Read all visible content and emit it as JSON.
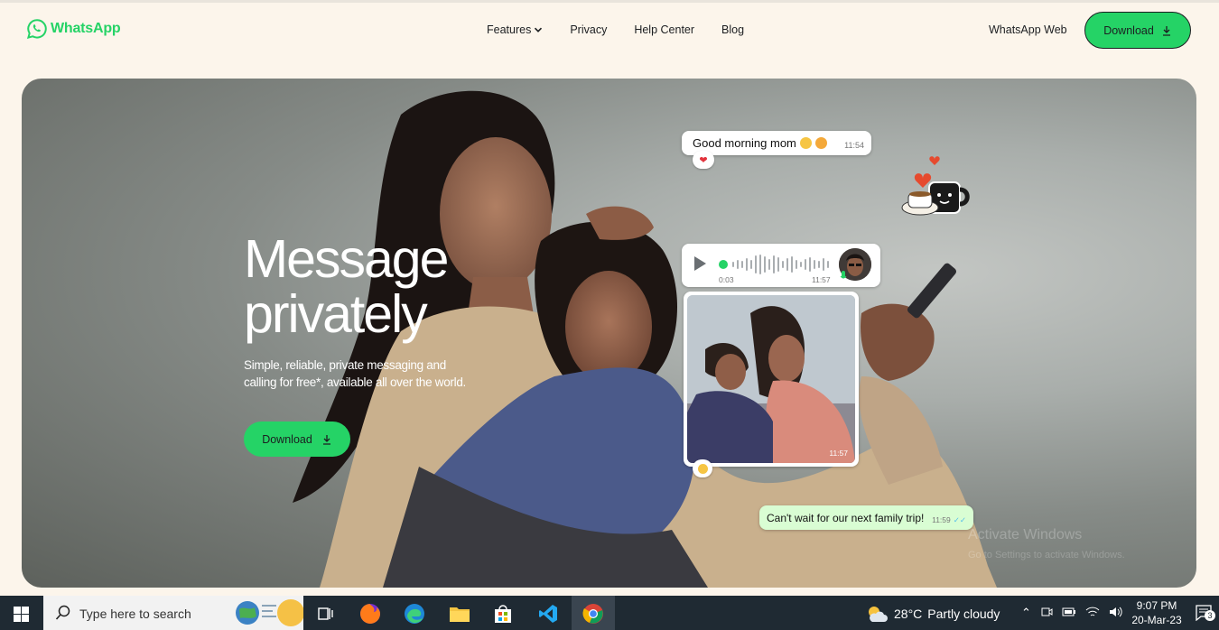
{
  "header": {
    "logo_text": "WhatsApp",
    "nav": [
      {
        "label": "Features",
        "has_dropdown": true
      },
      {
        "label": "Privacy"
      },
      {
        "label": "Help Center"
      },
      {
        "label": "Blog"
      }
    ],
    "whatsapp_web_label": "WhatsApp Web",
    "download_label": "Download"
  },
  "hero": {
    "title_line1": "Message",
    "title_line2": "privately",
    "subtitle": "Simple, reliable, private messaging and calling for free*, available all over the world.",
    "download_label": "Download",
    "chat": {
      "msg1_text": "Good morning mom",
      "msg1_time": "11:54",
      "voice_elapsed": "0:03",
      "voice_time": "11:57",
      "photo_time": "11:57",
      "msg4_text": "Can't wait for our next family trip!",
      "msg4_time": "11:59"
    },
    "watermark_line1": "Activate Windows",
    "watermark_line2": "Go to Settings to activate Windows."
  },
  "taskbar": {
    "search_placeholder": "Type here to search",
    "weather_temp": "28°C",
    "weather_desc": "Partly cloudy",
    "time": "9:07 PM",
    "date": "20-Mar-23",
    "notification_count": "3",
    "icons": [
      "windows-start-icon",
      "task-view-icon",
      "firefox-icon",
      "edge-icon",
      "file-explorer-icon",
      "store-icon",
      "vscode-icon",
      "chrome-icon"
    ]
  },
  "colors": {
    "brand_green": "#25d366",
    "page_bg": "#fcf5eb",
    "outgoing_bubble": "#d9fdd3",
    "taskbar_bg": "#1f2a33"
  }
}
